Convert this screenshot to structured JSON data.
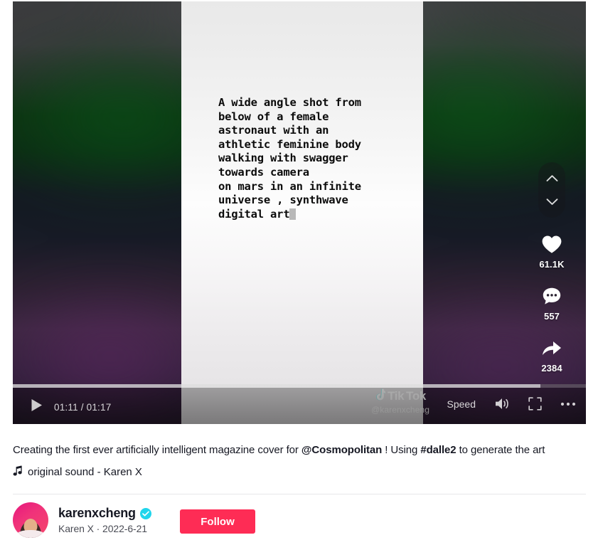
{
  "video": {
    "prompt_text": "A wide angle shot from\nbelow of a female\nastronaut with an\nathletic feminine body\nwalking with swagger\ntowards camera\non mars in an infinite\nuniverse , synthwave\ndigital art",
    "watermark": {
      "logo_tik": "Tik",
      "logo_tok": "Tok",
      "handle": "@karenxcheng"
    }
  },
  "actions": {
    "prev_icon": "chevron-up-icon",
    "next_icon": "chevron-down-icon",
    "like": {
      "icon": "heart-icon",
      "count": "61.1K"
    },
    "comment": {
      "icon": "comment-icon",
      "count": "557"
    },
    "share": {
      "icon": "share-icon",
      "count": "2384"
    }
  },
  "controls": {
    "play_icon": "play-icon",
    "time": "01:11 / 01:17",
    "current_time": "01:11",
    "duration": "01:17",
    "progress_percent": 92,
    "speed_label": "Speed",
    "volume_icon": "volume-icon",
    "fullscreen_icon": "fullscreen-icon",
    "more_icon": "more-horizontal-icon"
  },
  "caption": {
    "part1": "Creating the first ever artificially intelligent magazine cover for ",
    "mention": "@Cosmopolitan",
    "part2": " ! Using ",
    "hashtag": "#dalle2",
    "part3": " to generate the art"
  },
  "music": {
    "note_icon": "music-note-icon",
    "label": "original sound - Karen X"
  },
  "author": {
    "avatar_icon": "avatar",
    "username": "karenxcheng",
    "verified_icon": "verified-badge-icon",
    "subtitle": "Karen X · 2022-6-21",
    "follow_label": "Follow"
  },
  "colors": {
    "brand_red": "#FE2C55",
    "brand_cyan": "#25F4EE",
    "verified_blue": "#20D5EC",
    "text_primary": "#161823"
  }
}
